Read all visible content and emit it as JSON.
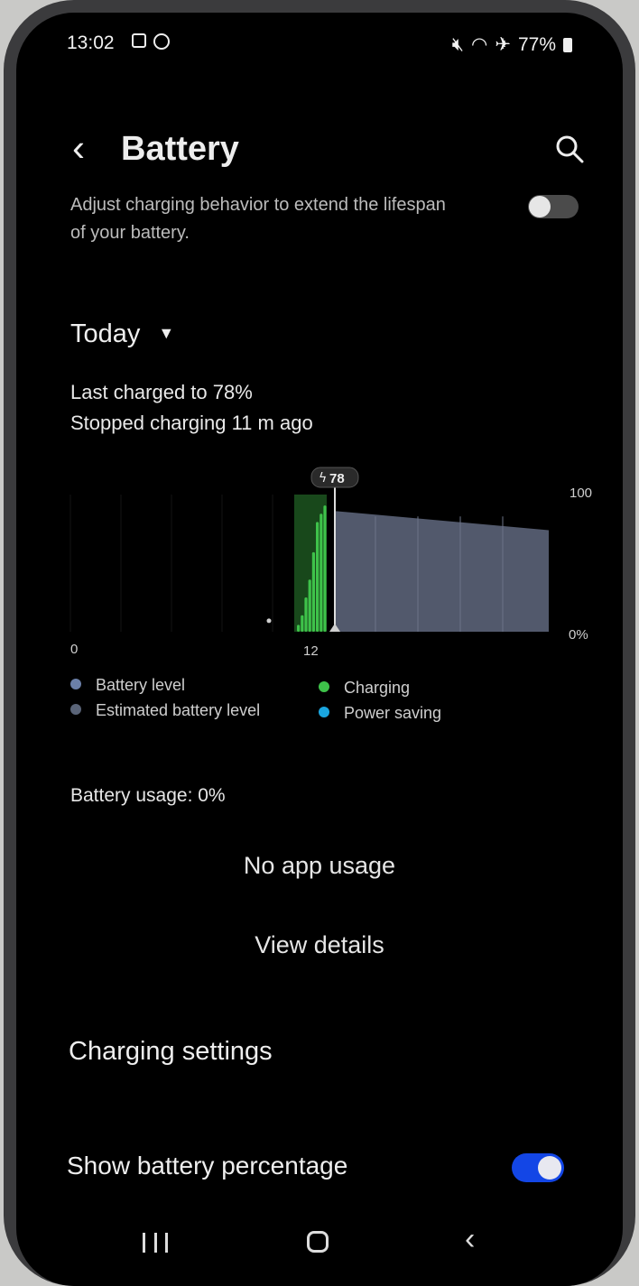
{
  "status_bar": {
    "time": "13:02",
    "battery_percent": "77%"
  },
  "header": {
    "title": "Battery"
  },
  "adaptive": {
    "description": "Adjust charging behavior to extend the lifespan of your battery.",
    "enabled": false
  },
  "period": {
    "label": "Today"
  },
  "charge_info": {
    "line1": "Last charged to 78%",
    "line2": "Stopped charging 11 m ago"
  },
  "chart_data": {
    "type": "bar",
    "x_labels": [
      "0",
      "12"
    ],
    "y_labels": [
      "100",
      "0%"
    ],
    "marker_label": "78",
    "legend": [
      {
        "label": "Battery level",
        "color": "#6b7fa8"
      },
      {
        "label": "Estimated battery level",
        "color": "#5a6478"
      },
      {
        "label": "Charging",
        "color": "#3ec24a"
      },
      {
        "label": "Power saving",
        "color": "#1aa6e0"
      }
    ],
    "charging_bars": [
      5,
      12,
      25,
      38,
      58,
      80,
      86,
      92
    ],
    "estimated_start": 88,
    "estimated_end": 74
  },
  "usage": {
    "label": "Battery usage: 0%",
    "empty": "No app usage",
    "details_label": "View details"
  },
  "settings": {
    "charging_label": "Charging settings",
    "show_pct_label": "Show battery percentage",
    "show_pct_enabled": true
  }
}
